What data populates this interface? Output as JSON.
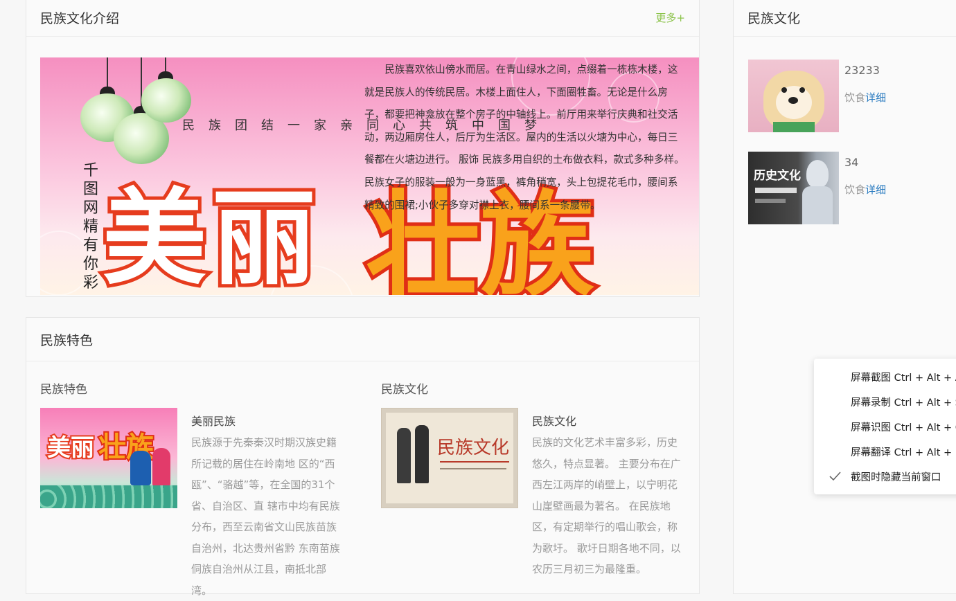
{
  "intro": {
    "title": "民族文化介绍",
    "more": "更多+",
    "banner_slogan": "民族团结一家亲同心共筑中国梦",
    "banner_vertical": "千图网精有你彩",
    "banner_big_left": "美丽",
    "banner_big_right": "壮族",
    "text": "民族喜欢依山傍水而居。在青山绿水之间，点缀着一栋栋木楼，这就是民族人的传统民居。木楼上面住人，下面圈牲畜。无论是什么房子，都要把神龛放在整个房子的中轴线上。前厅用来举行庆典和社交活动，两边厢房住人，后厅为生活区。屋内的生活以火塘为中心，每日三餐都在火塘边进行。 服饰 民族多用自织的土布做衣料，款式多种多样。民族女子的服装一般为一身蓝黑，裤角稍宽，头上包提花毛巾，腰间系精致的围裙;小伙子多穿对襟上衣，腰间系一条腰带。"
  },
  "features": {
    "title": "民族特色",
    "left": {
      "heading": "民族特色",
      "image_text_a": "美丽",
      "image_text_b": "壮族",
      "card_title": "美丽民族",
      "card_desc": "民族源于先秦秦汉时期汉族史籍所记载的居住在岭南地 区的“西瓯”、“骆越”等，在全国的31个省、自治区、直 辖市中均有民族分布，西至云南省文山民族苗族自治州，北达贵州省黔 东南苗族侗族自治州从江县，南抵北部湾。"
    },
    "right": {
      "heading": "民族文化",
      "image_text": "民族文化",
      "card_title": "民族文化",
      "card_desc": "民族的文化艺术丰富多彩，历史悠久，特点显著。 主要分布在广西左江两岸的峭壁上，以宁明花山崖壁画最为著名。 在民族地区，有定期举行的唱山歌会，称为歌圩。 歌圩日期各地不同，以农历三月初三为最隆重。"
    }
  },
  "sidebar": {
    "title": "民族文化",
    "items": [
      {
        "number": "23233",
        "category": "饮食",
        "link": "详细"
      },
      {
        "number": "34",
        "category": "饮食",
        "link": "详细",
        "image_text": "历史文化"
      }
    ]
  },
  "context_menu": {
    "items": [
      {
        "label": "屏幕截图 Ctrl + Alt + A"
      },
      {
        "label": "屏幕录制 Ctrl + Alt + S"
      },
      {
        "label": "屏幕识图 Ctrl + Alt + O"
      },
      {
        "label": "屏幕翻译 Ctrl + Alt + F"
      },
      {
        "label": "截图时隐藏当前窗口",
        "checked": true
      }
    ]
  },
  "colors": {
    "accent_green": "#8bc34a",
    "link_blue": "#2a7bc0"
  }
}
